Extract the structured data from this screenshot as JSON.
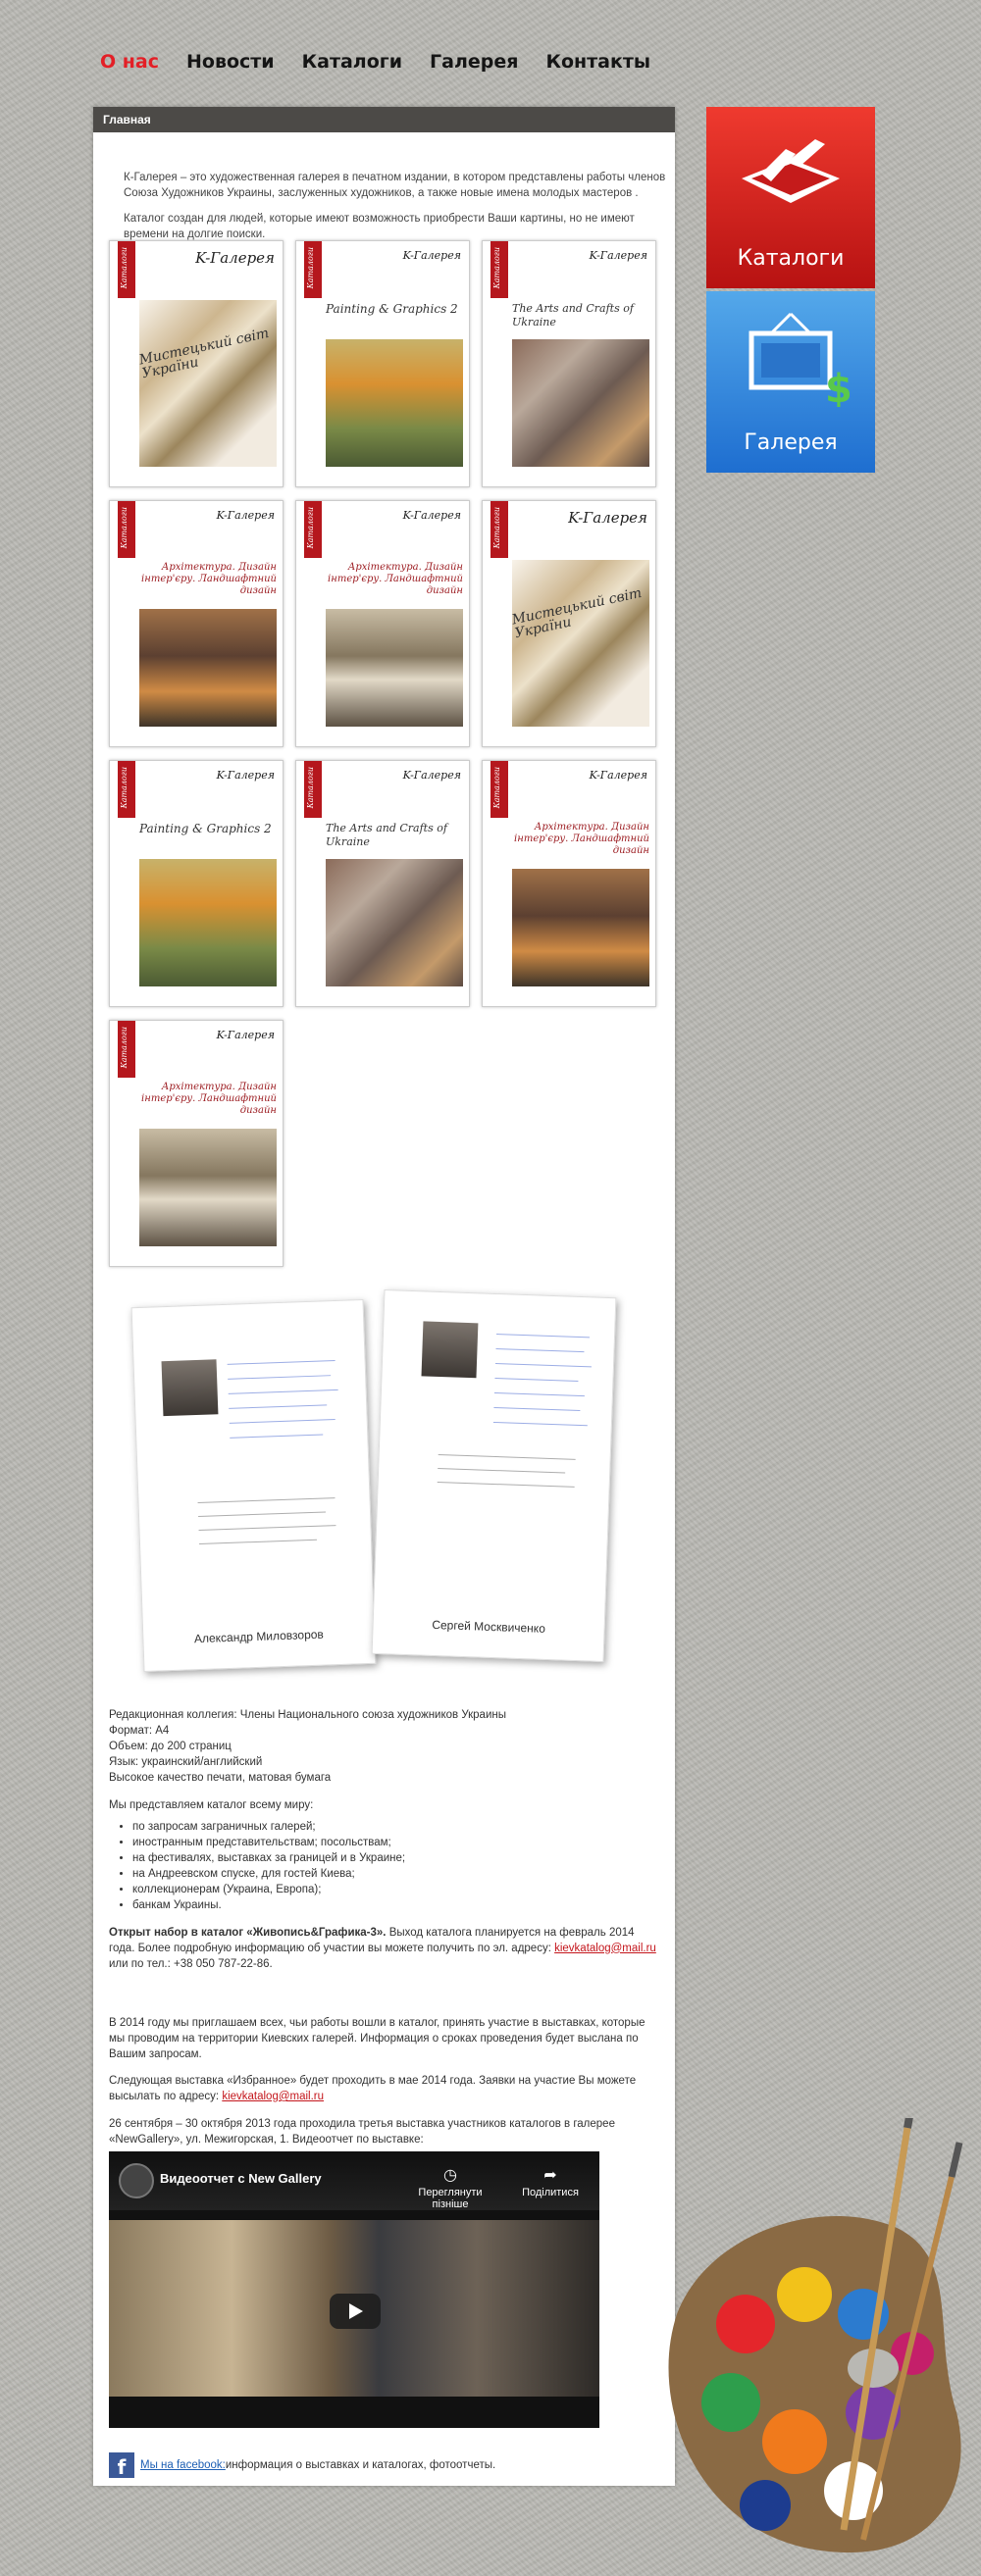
{
  "nav": {
    "items": [
      "О нас",
      "Новости",
      "Каталоги",
      "Галерея",
      "Контакты"
    ],
    "active": "О нас"
  },
  "main": {
    "title": "Главная",
    "intro1": "К-Галерея – это художественная галерея в печатном издании, в котором представлены работы членов Союза Художников Украины, заслуженных художников, а также новые имена молодых мастеров .",
    "intro2": "Каталог создан для людей, которые имеют возможность приобрести Ваши картины, но не имеют времени на долгие поиски."
  },
  "catalogs": {
    "brand": "K-Галерея",
    "tab": "Каталоги",
    "titles": {
      "ukraine": "Мистецький світ України",
      "painting": "Painting & Graphics 2",
      "crafts": "The Arts and Crafts of Ukraine",
      "arch": "Архітектура. Дизайн інтер'єру. Ландшафтний дизайн"
    }
  },
  "letters": {
    "left_name": "Александр Миловзоров",
    "right_name": "Сергей Москвиченко"
  },
  "details": {
    "editorial": "Редакционная коллегия: Члены Национального союза художников Украины",
    "format": "Формат: А4",
    "volume": "Объем: до 200 страниц",
    "language": "Язык: украинский/английский",
    "quality": "Высокое качество печати, матовая бумага",
    "present_intro": "Мы представляем каталог всему миру:",
    "present_list": [
      "по запросам заграничных галерей;",
      "иностранным представительствам; посольствам;",
      "на фестивалях, выставках за границей и в Украине;",
      "на Андреевском спуске, для гостей Киева;",
      "коллекционерам (Украина, Европа);",
      "банкам Украины."
    ],
    "open_bold": "Открыт набор в каталог «Живопись&Графика-3».",
    "open_text": " Выход каталога планируется на февраль 2014 года. Более подробную информацию об участии вы можете получить по эл. адресу: ",
    "open_email": "kievkatalog@mail.ru",
    "open_phone": " или по тел.: +38 050 787-22-86.",
    "invite": "В 2014 году мы приглашаем всех, чьи работы вошли в каталог, принять участие в выставках, которые мы проводим на территории Киевских галерей. Информация о сроках проведения будет выслана по Вашим запросам.",
    "next_show": "Следующая выставка «Избранное» будет проходить в мае 2014 года. Заявки на участие Вы можете высылать по адресу: ",
    "next_email": "kievkatalog@mail.ru",
    "past_show": "26 сентября – 30 октября 2013 года проходила третья выставка участников каталогов в галерее «NewGallery», ул. Межигорская, 1. Видеоотчет по выставке:"
  },
  "video": {
    "title": "Видеоотчет с New Gallery",
    "watch_later": "Переглянути пізніше",
    "share": "Поділитися"
  },
  "facebook": {
    "link": "Мы на facebook:",
    "text": " информация о выставках и каталогах, фотоотчеты."
  },
  "tiles": {
    "catalogs": "Каталоги",
    "gallery": "Галерея"
  },
  "colors": {
    "accent": "#e31f26",
    "header": "#4c4a47",
    "tile_red": "#d42020",
    "tile_blue": "#2f85dc"
  }
}
